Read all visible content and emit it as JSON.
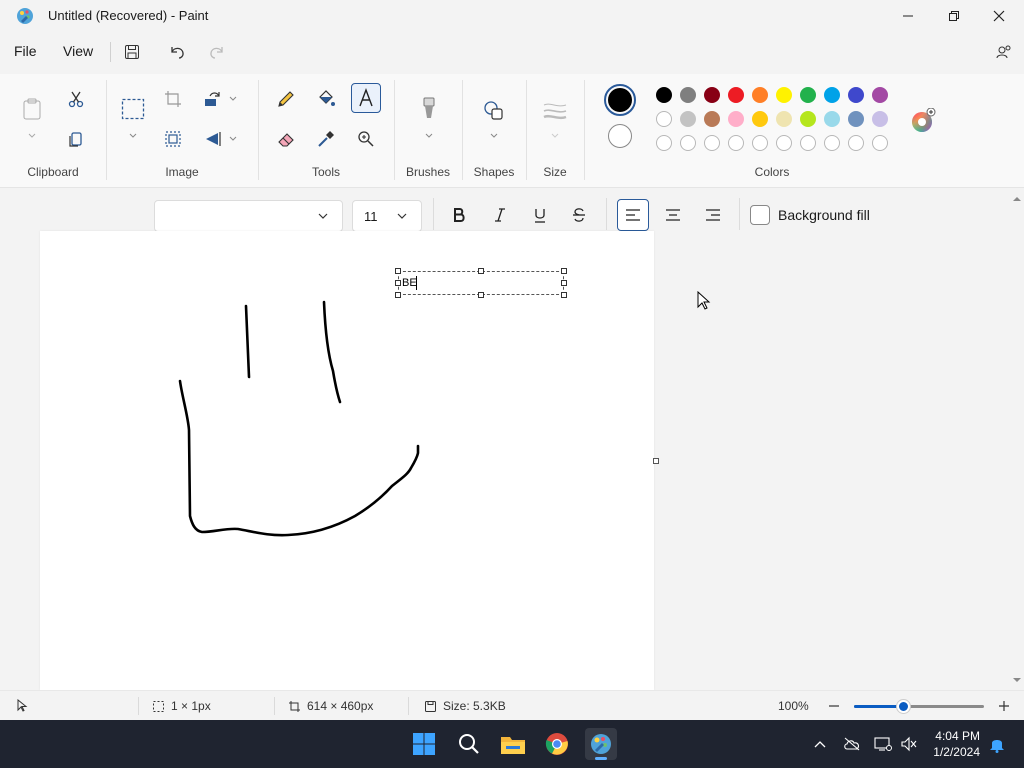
{
  "window": {
    "title": "Untitled (Recovered) - Paint"
  },
  "menu": {
    "file": "File",
    "view": "View"
  },
  "ribbon": {
    "groups": {
      "clipboard": "Clipboard",
      "image": "Image",
      "tools": "Tools",
      "brushes": "Brushes",
      "shapes": "Shapes",
      "size": "Size",
      "colors": "Colors"
    },
    "active_tool": "text-tool",
    "primary_color": "#000000",
    "secondary_color": "#ffffff",
    "palette_row1": [
      "#000000",
      "#7f7f7f",
      "#880015",
      "#ed1c24",
      "#ff7f27",
      "#fff200",
      "#22b14c",
      "#00a2e8",
      "#3f48cc",
      "#a349a4"
    ],
    "palette_row2": [
      "#ffffff",
      "#c3c3c3",
      "#b97a57",
      "#ffaec9",
      "#ffc90e",
      "#efe4b0",
      "#b5e61d",
      "#99d9ea",
      "#7092be",
      "#c8bfe7"
    ],
    "palette_row3_empty_count": 10
  },
  "text_toolbar": {
    "font_name": "",
    "font_size": "11",
    "background_fill_label": "Background fill",
    "alignment": "left"
  },
  "canvas": {
    "text_box_content": "BE"
  },
  "status": {
    "selection_size": "1 × 1px",
    "canvas_size": "614 × 460px",
    "file_size": "Size: 5.3KB",
    "zoom": "100%",
    "zoom_level": 0.38
  },
  "taskbar": {
    "time": "4:04 PM",
    "date": "1/2/2024"
  }
}
